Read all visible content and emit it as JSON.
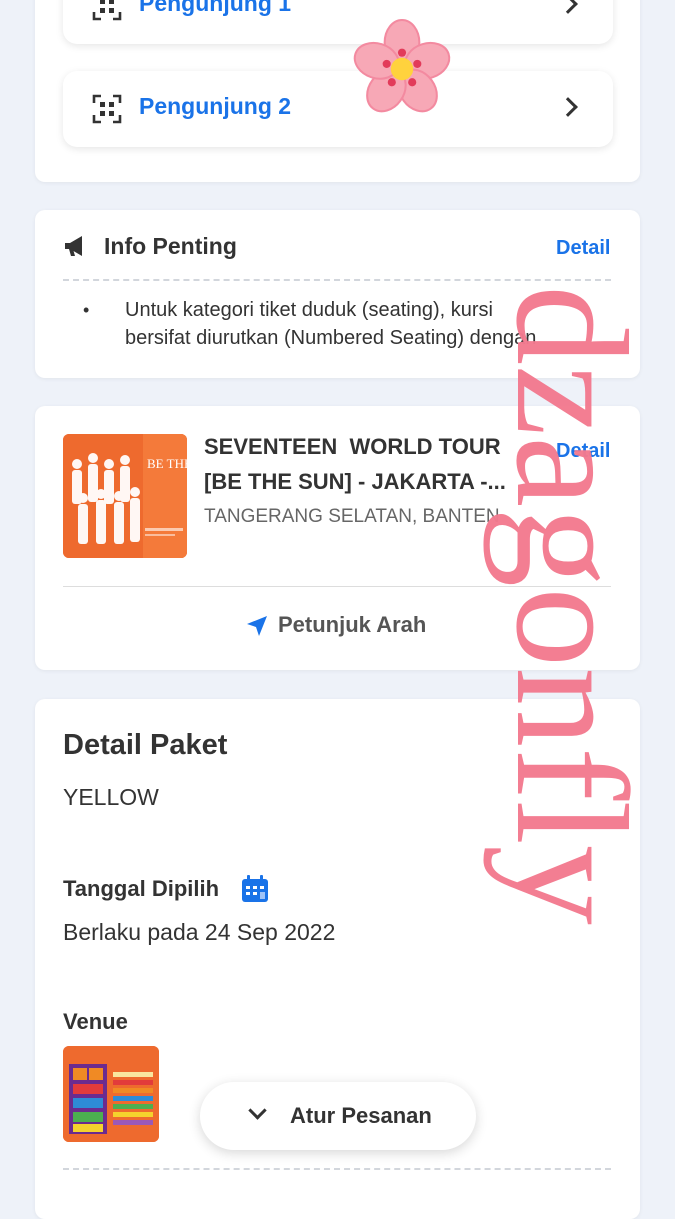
{
  "visitors": [
    "Pengunjung 1",
    "Pengunjung 2"
  ],
  "info": {
    "title": "Info Penting",
    "detail_label": "Detail",
    "bullet": "•",
    "line1": "Untuk kategori tiket duduk (seating), kursi",
    "line2": "bersifat diurutkan (Numbered Seating) dengan"
  },
  "event": {
    "title_line1": "SEVENTEEN  WORLD TOUR",
    "title_line2": "[BE THE SUN] - JAKARTA -...",
    "location": "TANGERANG SELATAN, BANTEN",
    "detail_label": "Detail",
    "directions_label": "Petunjuk Arah",
    "poster_text": "BE THE"
  },
  "package": {
    "heading": "Detail Paket",
    "name": "YELLOW",
    "date_label": "Tanggal Dipilih",
    "date_value": "Berlaku pada 24 Sep 2022",
    "venue_label": "Venue"
  },
  "bottom_button": {
    "label": "Atur Pesanan"
  },
  "overlay": {
    "watermark": "dzagonfly"
  },
  "colors": {
    "accent": "#1a73e8",
    "watermark": "#f37a8f",
    "background": "#eef2f9",
    "poster": "#ee6a2e"
  },
  "icons": {
    "qr": "qr-code-icon",
    "megaphone": "megaphone-icon",
    "navigation": "navigation-arrow-icon",
    "calendar": "calendar-icon",
    "chevron_right": "chevron-right-icon",
    "chevron_down": "chevron-down-icon",
    "flower": "cherry-blossom-sticker"
  }
}
